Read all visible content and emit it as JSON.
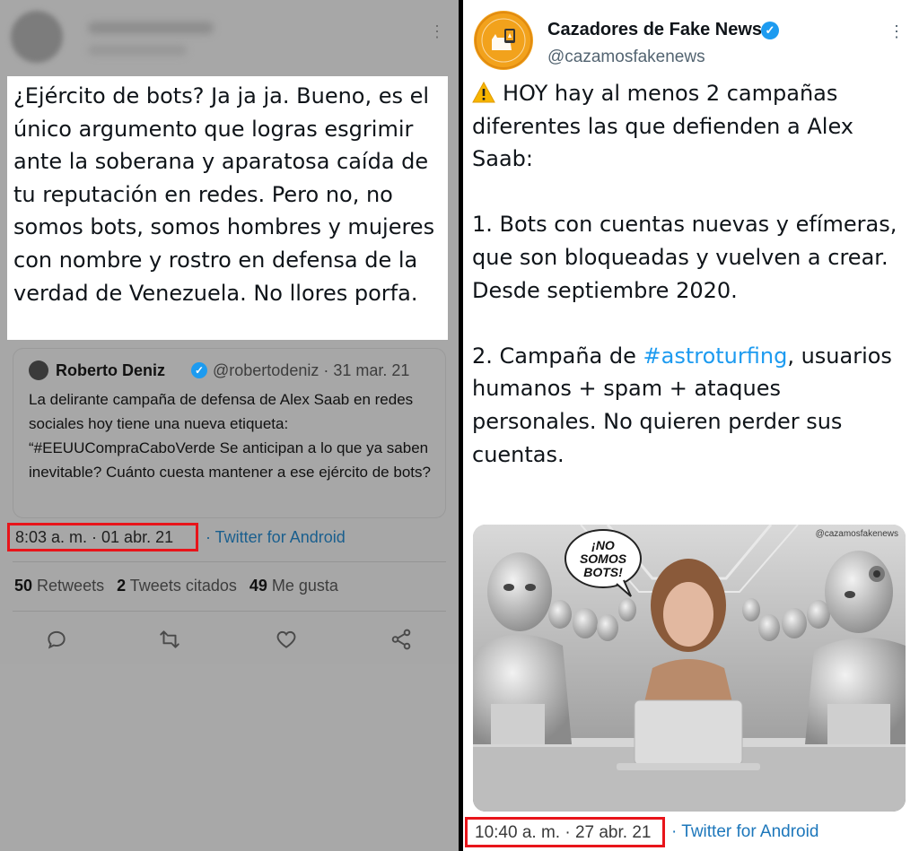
{
  "left_tweet": {
    "body": "¿Ejército de bots? Ja ja ja. Bueno, es el único argumento que logras esgrimir ante la soberana y aparatosa caída de tu reputación en redes. Pero no, no somos bots, somos hombres y mujeres con nombre y rostro en defensa de la verdad de Venezuela. No llores porfa.",
    "quoted": {
      "name": "Roberto Deniz",
      "meta": "@robertodeniz · 31 mar. 21",
      "text": "La delirante campaña de defensa de Alex Saab en redes sociales hoy tiene una nueva etiqueta: “#EEUUCompraCaboVerde Se anticipan a lo que ya saben inevitable? Cuánto cuesta mantener a ese ejército de bots?"
    },
    "timestamp": "8:03 a. m. · 01 abr. 21",
    "via": "· Twitter for Android",
    "stats": {
      "retweets_count": "50",
      "retweets_label": "Retweets",
      "quotes_count": "2",
      "quotes_label": "Tweets citados",
      "likes_count": "49",
      "likes_label": "Me gusta"
    },
    "actions": [
      "reply-icon",
      "retweet-icon",
      "like-icon",
      "share-icon"
    ]
  },
  "right_tweet": {
    "name": "Cazadores de Fake News",
    "handle": "@cazamosfakenews",
    "paragraphs": {
      "p1": "HOY hay al menos 2 campañas diferentes las que defienden a Alex Saab:",
      "p2": "1. Bots con cuentas nuevas y efímeras, que son bloqueadas y vuelven a crear. Desde septiembre 2020.",
      "p3_before": "2. Campaña de ",
      "p3_hashtag": "#astroturfing",
      "p3_after": ", usuarios humanos + spam + ataques personales. No quieren perder sus cuentas."
    },
    "image": {
      "speech_bubble": "¡NO SOMOS BOTS!",
      "watermark": "@cazamosfakenews"
    },
    "timestamp": "10:40 a. m. · 27 abr. 21",
    "via": "· Twitter for Android"
  },
  "colors": {
    "link": "#1d9bf0",
    "highlight_border": "#e8141a",
    "dimmed_overlay": "#a7a7a7",
    "logo_orange": "#f2a21c"
  },
  "icons": [
    "more-options-icon",
    "verified-badge-icon",
    "warning-icon"
  ]
}
